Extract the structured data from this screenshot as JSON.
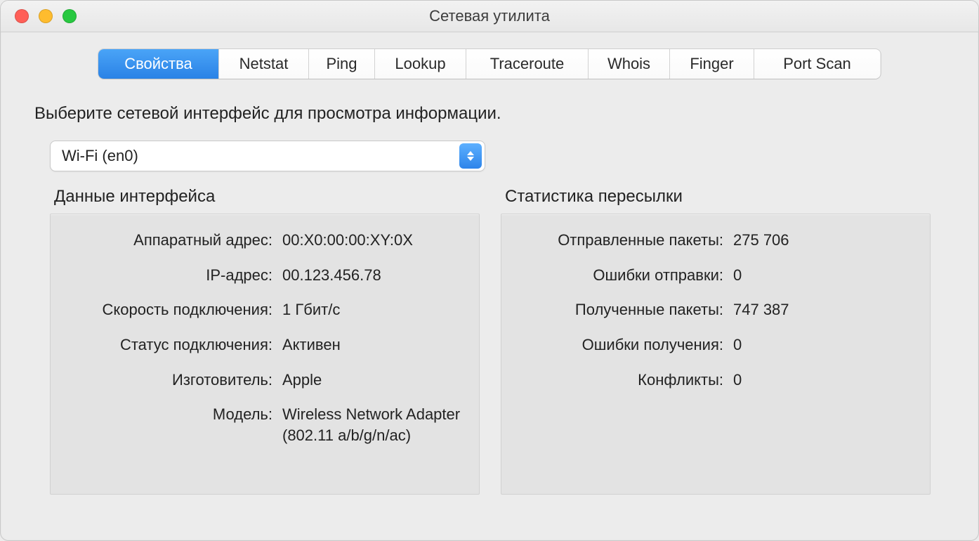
{
  "window": {
    "title": "Сетевая утилита"
  },
  "tabs": {
    "items": [
      "Свойства",
      "Netstat",
      "Ping",
      "Lookup",
      "Traceroute",
      "Whois",
      "Finger",
      "Port Scan"
    ],
    "active_index": 0
  },
  "instruction": "Выберите сетевой интерфейс для просмотра информации.",
  "interface_select": {
    "value": "Wi-Fi (en0)"
  },
  "left_panel": {
    "title": "Данные интерфейса",
    "rows": {
      "hw_addr": {
        "label": "Аппаратный адрес:",
        "value": "00:X0:00:00:XY:0X"
      },
      "ip_addr": {
        "label": "IP-адрес:",
        "value": "00.123.456.78"
      },
      "speed": {
        "label": "Скорость подключения:",
        "value": "1 Гбит/с"
      },
      "status": {
        "label": "Статус подключения:",
        "value": "Активен"
      },
      "vendor": {
        "label": "Изготовитель:",
        "value": "Apple"
      },
      "model": {
        "label": "Модель:",
        "value": "Wireless Network Adapter (802.11 a/b/g/n/ac)"
      }
    }
  },
  "right_panel": {
    "title": "Статистика пересылки",
    "rows": {
      "sent": {
        "label": "Отправленные пакеты:",
        "value": "275 706"
      },
      "send_err": {
        "label": "Ошибки отправки:",
        "value": "0"
      },
      "recv": {
        "label": "Полученные пакеты:",
        "value": "747 387"
      },
      "recv_err": {
        "label": "Ошибки получения:",
        "value": "0"
      },
      "collisions": {
        "label": "Конфликты:",
        "value": "0"
      }
    }
  }
}
